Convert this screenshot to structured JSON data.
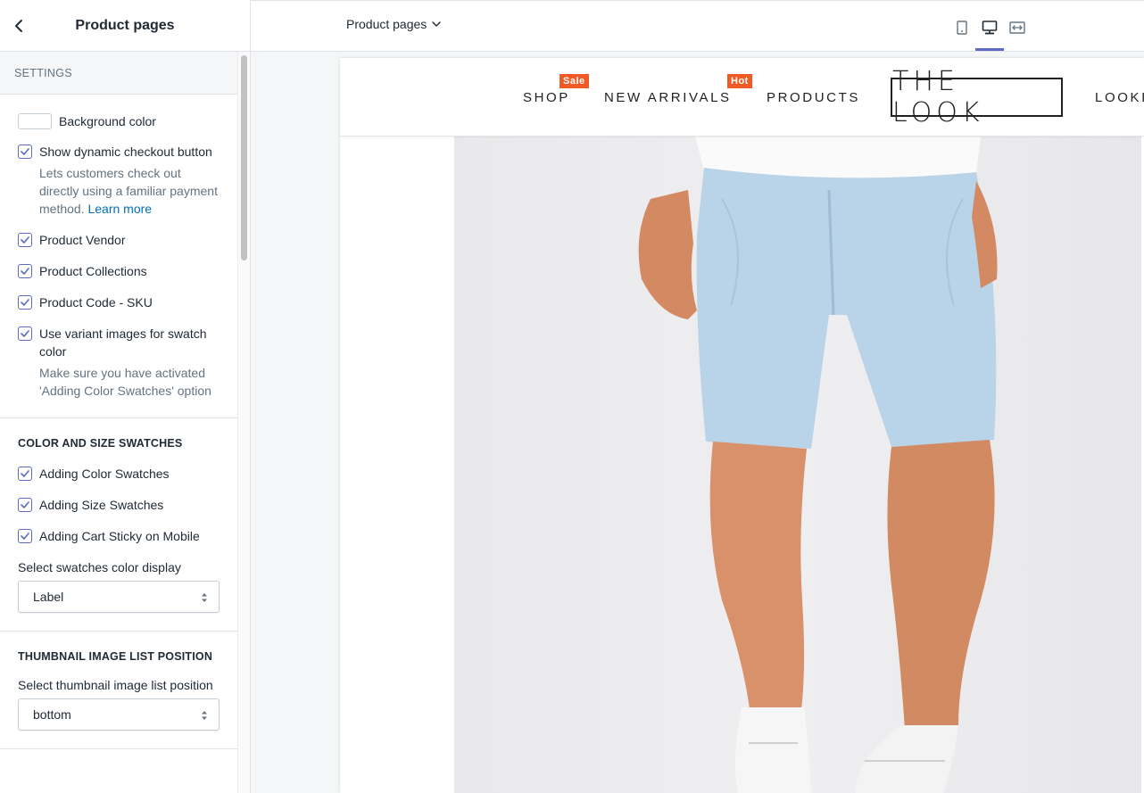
{
  "sidebar": {
    "title": "Product pages",
    "settings_header": "SETTINGS",
    "background_color_label": "Background color",
    "background_color_value": "#ffffff",
    "checkboxes": [
      {
        "label": "Show dynamic checkout button",
        "checked": true,
        "help": "Lets customers check out directly using a familiar payment method.",
        "help_link": "Learn more"
      },
      {
        "label": "Product Vendor",
        "checked": true
      },
      {
        "label": "Product Collections",
        "checked": true
      },
      {
        "label": "Product Code - SKU",
        "checked": true
      },
      {
        "label": "Use variant images for swatch color",
        "checked": true,
        "help": "Make sure you have activated 'Adding Color Swatches' option"
      }
    ],
    "swatches_section": {
      "title": "COLOR AND SIZE SWATCHES",
      "checkboxes": [
        {
          "label": "Adding Color Swatches",
          "checked": true
        },
        {
          "label": "Adding Size Swatches",
          "checked": true
        },
        {
          "label": "Adding Cart Sticky on Mobile",
          "checked": true
        }
      ],
      "select_label": "Select swatches color display",
      "select_value": "Label"
    },
    "thumbnail_section": {
      "title": "THUMBNAIL IMAGE LIST POSITION",
      "select_label": "Select thumbnail image list position",
      "select_value": "bottom"
    }
  },
  "toolbar": {
    "page_selector": "Product pages",
    "views": [
      "mobile-view-icon",
      "desktop-view-icon",
      "fullscreen-view-icon"
    ],
    "active_view": "desktop"
  },
  "store": {
    "nav": [
      {
        "label": "SHOP",
        "badge": "Sale"
      },
      {
        "label": "NEW ARRIVALS",
        "badge": "Hot"
      },
      {
        "label": "PRODUCTS"
      },
      {
        "label": "LOOKI"
      }
    ],
    "logo": "THE LOOK",
    "badge_color": "#f15a24"
  },
  "colors": {
    "accent": "#5c6ac4",
    "link": "#006fbb"
  }
}
